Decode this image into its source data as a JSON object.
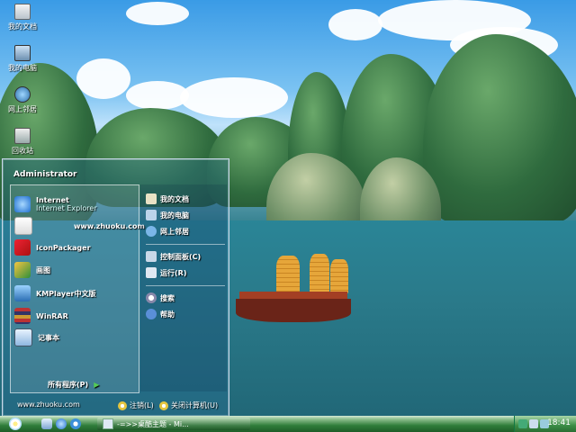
{
  "desktop": {
    "icons": [
      {
        "label": "我的文档",
        "icon": "my-documents-icon"
      },
      {
        "label": "我的电脑",
        "icon": "my-computer-icon"
      },
      {
        "label": "网上邻居",
        "icon": "network-places-icon"
      },
      {
        "label": "回收站",
        "icon": "recycle-bin-icon"
      }
    ]
  },
  "start_menu": {
    "user": "Administrator",
    "pinned": [
      {
        "label": "Internet",
        "sub": "Internet Explorer",
        "icon": "internet-explorer-icon"
      },
      {
        "label": "www.zhuoku.com",
        "icon": "zhuoku-site-icon"
      }
    ],
    "programs": [
      {
        "label": "IconPackager",
        "icon": "iconpackager-icon"
      },
      {
        "label": "画图",
        "icon": "paint-icon"
      },
      {
        "label": "KMPlayer中文版",
        "icon": "kmplayer-icon"
      },
      {
        "label": "WinRAR",
        "icon": "winrar-icon"
      },
      {
        "label": "记事本",
        "icon": "notepad-icon"
      }
    ],
    "all_programs": "所有程序(P)",
    "right": [
      {
        "label": "我的文档",
        "icon": "my-documents-icon"
      },
      {
        "label": "我的电脑",
        "icon": "my-computer-icon"
      },
      {
        "label": "网上邻居",
        "icon": "network-places-icon"
      },
      {
        "label": "控制面板(C)",
        "icon": "control-panel-icon"
      },
      {
        "label": "运行(R)",
        "icon": "run-icon"
      },
      {
        "label": "搜索",
        "icon": "search-icon"
      },
      {
        "label": "帮助",
        "icon": "help-icon"
      }
    ],
    "site": "www.zhuoku.com",
    "logoff": "注销(L)",
    "shutdown": "关闭计算机(U)"
  },
  "taskbar": {
    "task_label": "-=>>桌酷主题 - Mi...",
    "clock": "18:41"
  }
}
